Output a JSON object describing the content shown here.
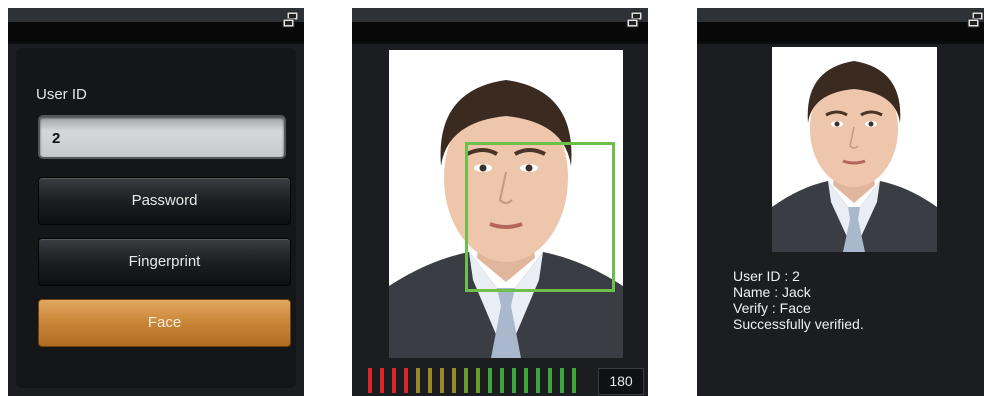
{
  "login_screen": {
    "user_id_label": "User ID",
    "user_id_value": "2",
    "buttons": {
      "password": "Password",
      "fingerprint": "Fingerprint",
      "face": "Face"
    }
  },
  "capture_screen": {
    "quality_score": "180",
    "meter_colors": [
      "#d9272c",
      "#d9272c",
      "#d9272c",
      "#d9272c",
      "#9a8b29",
      "#9a8b29",
      "#9a8b29",
      "#9a8b29",
      "#6a9c2c",
      "#6a9c2c",
      "#3fa63c",
      "#3fa63c",
      "#3fa63c",
      "#3fa63c",
      "#3fa63c",
      "#3fa63c",
      "#3fa63c",
      "#3fa63c"
    ],
    "face_box_color": "#6cc04a"
  },
  "result_screen": {
    "lines": {
      "user_id": "User ID : 2",
      "name": "Name : Jack",
      "verify": "Verify : Face",
      "status": "Successfully verified."
    }
  },
  "icons": [
    "network-icon",
    "face-photo"
  ],
  "colors": {
    "face_button": "#c98536",
    "panel_bg": "#1b1d20"
  }
}
